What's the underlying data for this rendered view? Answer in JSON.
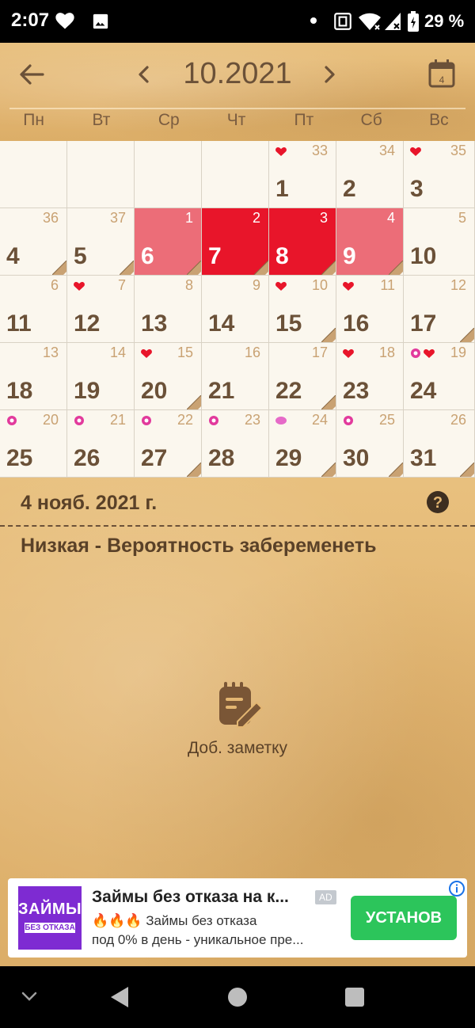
{
  "status_bar": {
    "time": "2:07",
    "battery": "29 %"
  },
  "header": {
    "month_title": "10.2021",
    "calendar_badge": "4"
  },
  "weekdays": [
    "Пн",
    "Вт",
    "Ср",
    "Чт",
    "Пт",
    "Сб",
    "Вс"
  ],
  "calendar": {
    "cells": [
      {
        "day": "",
        "cycle": ""
      },
      {
        "day": "",
        "cycle": ""
      },
      {
        "day": "",
        "cycle": ""
      },
      {
        "day": "",
        "cycle": ""
      },
      {
        "day": "1",
        "cycle": "33",
        "marker": "heart"
      },
      {
        "day": "2",
        "cycle": "34"
      },
      {
        "day": "3",
        "cycle": "35",
        "marker": "heart"
      },
      {
        "day": "4",
        "cycle": "36",
        "note": true
      },
      {
        "day": "5",
        "cycle": "37",
        "note": true
      },
      {
        "day": "6",
        "cycle": "1",
        "period": "light",
        "note": true
      },
      {
        "day": "7",
        "cycle": "2",
        "period": "heavy",
        "note": true
      },
      {
        "day": "8",
        "cycle": "3",
        "period": "heavy",
        "note": true
      },
      {
        "day": "9",
        "cycle": "4",
        "period": "light",
        "note": true
      },
      {
        "day": "10",
        "cycle": "5"
      },
      {
        "day": "11",
        "cycle": "6"
      },
      {
        "day": "12",
        "cycle": "7",
        "marker": "heart"
      },
      {
        "day": "13",
        "cycle": "8"
      },
      {
        "day": "14",
        "cycle": "9"
      },
      {
        "day": "15",
        "cycle": "10",
        "marker": "heart",
        "note": true
      },
      {
        "day": "16",
        "cycle": "11",
        "marker": "heart"
      },
      {
        "day": "17",
        "cycle": "12",
        "note": true
      },
      {
        "day": "18",
        "cycle": "13"
      },
      {
        "day": "19",
        "cycle": "14"
      },
      {
        "day": "20",
        "cycle": "15",
        "marker": "heart",
        "note": true
      },
      {
        "day": "21",
        "cycle": "16"
      },
      {
        "day": "22",
        "cycle": "17",
        "note": true
      },
      {
        "day": "23",
        "cycle": "18",
        "marker": "heart"
      },
      {
        "day": "24",
        "cycle": "19",
        "marker": "flower",
        "marker2": "heart"
      },
      {
        "day": "25",
        "cycle": "20",
        "marker": "flower"
      },
      {
        "day": "26",
        "cycle": "21",
        "marker": "flower"
      },
      {
        "day": "27",
        "cycle": "22",
        "marker": "flower",
        "note": true
      },
      {
        "day": "28",
        "cycle": "23",
        "marker": "flower"
      },
      {
        "day": "29",
        "cycle": "24",
        "marker": "pill",
        "note": true
      },
      {
        "day": "30",
        "cycle": "25",
        "marker": "flower",
        "note": true
      },
      {
        "day": "31",
        "cycle": "26",
        "note": true
      }
    ]
  },
  "details": {
    "selected_date": "4 нояб. 2021 г.",
    "fertility": "Низкая - Вероятность забеременеть",
    "add_note_label": "Доб. заметку"
  },
  "ad": {
    "image_line1": "ЗАЙМЫ",
    "image_line2": "БЕЗ ОТКАЗА",
    "title": "Займы без отказа на к...",
    "badge": "AD",
    "desc_line1": "Займы без отказа",
    "desc_line2": "под 0% в день - уникальное пре...",
    "cta": "УСТАНОВ"
  },
  "colors": {
    "leather": "#e3b672",
    "text_brown": "#6b5138",
    "period_light": "#ec6d78",
    "period_heavy": "#e8152a",
    "cta_green": "#2cc55b"
  }
}
